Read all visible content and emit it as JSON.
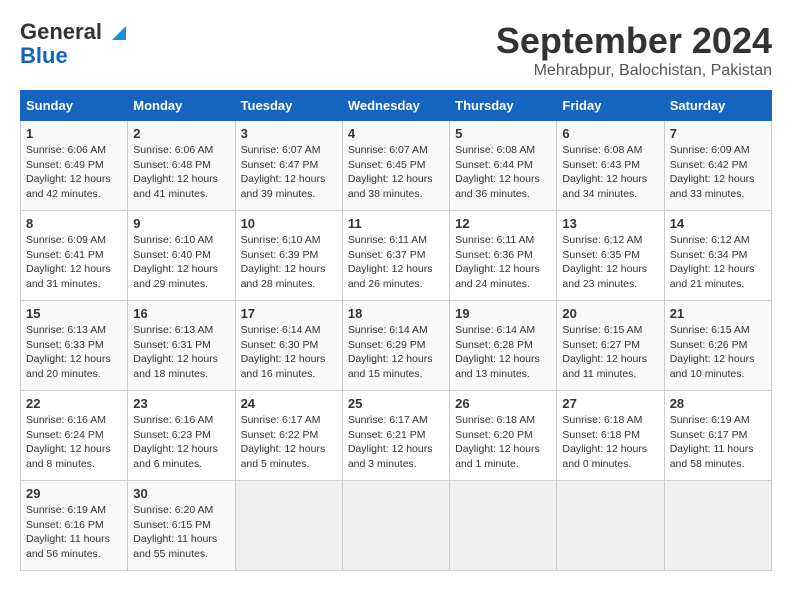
{
  "header": {
    "logo_line1": "General",
    "logo_line2": "Blue",
    "title": "September 2024",
    "subtitle": "Mehrabpur, Balochistan, Pakistan"
  },
  "calendar": {
    "days_of_week": [
      "Sunday",
      "Monday",
      "Tuesday",
      "Wednesday",
      "Thursday",
      "Friday",
      "Saturday"
    ],
    "weeks": [
      [
        null,
        {
          "day": "2",
          "sunrise": "6:06 AM",
          "sunset": "6:48 PM",
          "daylight": "12 hours and 41 minutes."
        },
        {
          "day": "3",
          "sunrise": "6:07 AM",
          "sunset": "6:47 PM",
          "daylight": "12 hours and 39 minutes."
        },
        {
          "day": "4",
          "sunrise": "6:07 AM",
          "sunset": "6:45 PM",
          "daylight": "12 hours and 38 minutes."
        },
        {
          "day": "5",
          "sunrise": "6:08 AM",
          "sunset": "6:44 PM",
          "daylight": "12 hours and 36 minutes."
        },
        {
          "day": "6",
          "sunrise": "6:08 AM",
          "sunset": "6:43 PM",
          "daylight": "12 hours and 34 minutes."
        },
        {
          "day": "7",
          "sunrise": "6:09 AM",
          "sunset": "6:42 PM",
          "daylight": "12 hours and 33 minutes."
        }
      ],
      [
        {
          "day": "1",
          "sunrise": "6:06 AM",
          "sunset": "6:49 PM",
          "daylight": "12 hours and 42 minutes."
        },
        null,
        null,
        null,
        null,
        null,
        null
      ],
      [
        {
          "day": "8",
          "sunrise": "6:09 AM",
          "sunset": "6:41 PM",
          "daylight": "12 hours and 31 minutes."
        },
        {
          "day": "9",
          "sunrise": "6:10 AM",
          "sunset": "6:40 PM",
          "daylight": "12 hours and 29 minutes."
        },
        {
          "day": "10",
          "sunrise": "6:10 AM",
          "sunset": "6:39 PM",
          "daylight": "12 hours and 28 minutes."
        },
        {
          "day": "11",
          "sunrise": "6:11 AM",
          "sunset": "6:37 PM",
          "daylight": "12 hours and 26 minutes."
        },
        {
          "day": "12",
          "sunrise": "6:11 AM",
          "sunset": "6:36 PM",
          "daylight": "12 hours and 24 minutes."
        },
        {
          "day": "13",
          "sunrise": "6:12 AM",
          "sunset": "6:35 PM",
          "daylight": "12 hours and 23 minutes."
        },
        {
          "day": "14",
          "sunrise": "6:12 AM",
          "sunset": "6:34 PM",
          "daylight": "12 hours and 21 minutes."
        }
      ],
      [
        {
          "day": "15",
          "sunrise": "6:13 AM",
          "sunset": "6:33 PM",
          "daylight": "12 hours and 20 minutes."
        },
        {
          "day": "16",
          "sunrise": "6:13 AM",
          "sunset": "6:31 PM",
          "daylight": "12 hours and 18 minutes."
        },
        {
          "day": "17",
          "sunrise": "6:14 AM",
          "sunset": "6:30 PM",
          "daylight": "12 hours and 16 minutes."
        },
        {
          "day": "18",
          "sunrise": "6:14 AM",
          "sunset": "6:29 PM",
          "daylight": "12 hours and 15 minutes."
        },
        {
          "day": "19",
          "sunrise": "6:14 AM",
          "sunset": "6:28 PM",
          "daylight": "12 hours and 13 minutes."
        },
        {
          "day": "20",
          "sunrise": "6:15 AM",
          "sunset": "6:27 PM",
          "daylight": "12 hours and 11 minutes."
        },
        {
          "day": "21",
          "sunrise": "6:15 AM",
          "sunset": "6:26 PM",
          "daylight": "12 hours and 10 minutes."
        }
      ],
      [
        {
          "day": "22",
          "sunrise": "6:16 AM",
          "sunset": "6:24 PM",
          "daylight": "12 hours and 8 minutes."
        },
        {
          "day": "23",
          "sunrise": "6:16 AM",
          "sunset": "6:23 PM",
          "daylight": "12 hours and 6 minutes."
        },
        {
          "day": "24",
          "sunrise": "6:17 AM",
          "sunset": "6:22 PM",
          "daylight": "12 hours and 5 minutes."
        },
        {
          "day": "25",
          "sunrise": "6:17 AM",
          "sunset": "6:21 PM",
          "daylight": "12 hours and 3 minutes."
        },
        {
          "day": "26",
          "sunrise": "6:18 AM",
          "sunset": "6:20 PM",
          "daylight": "12 hours and 1 minute."
        },
        {
          "day": "27",
          "sunrise": "6:18 AM",
          "sunset": "6:18 PM",
          "daylight": "12 hours and 0 minutes."
        },
        {
          "day": "28",
          "sunrise": "6:19 AM",
          "sunset": "6:17 PM",
          "daylight": "11 hours and 58 minutes."
        }
      ],
      [
        {
          "day": "29",
          "sunrise": "6:19 AM",
          "sunset": "6:16 PM",
          "daylight": "11 hours and 56 minutes."
        },
        {
          "day": "30",
          "sunrise": "6:20 AM",
          "sunset": "6:15 PM",
          "daylight": "11 hours and 55 minutes."
        },
        null,
        null,
        null,
        null,
        null
      ]
    ]
  }
}
